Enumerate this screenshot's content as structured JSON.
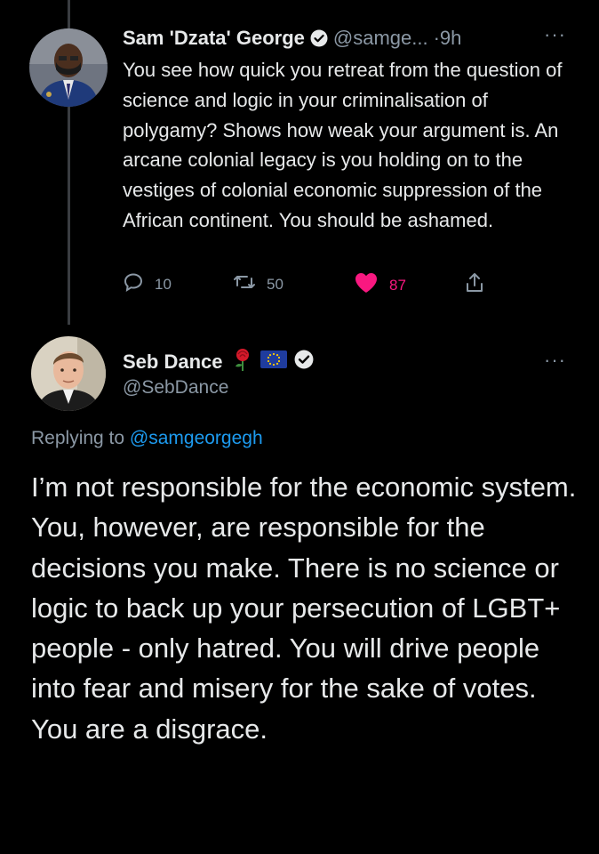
{
  "tweet1": {
    "name": "Sam 'Dzata' George",
    "handle": "@samge...",
    "time": "·9h",
    "more": "···",
    "text": "You see how quick you retreat from the question of science and logic in your criminalisation of polygamy? Shows how weak your argument is. An arcane colonial legacy is you holding on to the vestiges of colonial economic suppression of the African continent. You should be ashamed.",
    "replies": "10",
    "retweets": "50",
    "likes": "87",
    "liked": true,
    "icons": [
      "verified-badge-icon",
      "reply-icon",
      "retweet-icon",
      "heart-icon",
      "share-icon",
      "more-icon"
    ]
  },
  "tweet2": {
    "name": "Seb Dance",
    "handle": "@SebDance",
    "more": "···",
    "replying_prefix": "Replying to",
    "replying_to": "@samgeorgegh",
    "text": "I’m not responsible for the economic system. You, however, are responsible for the decisions you make. There is no science or logic to back up your persecution of LGBT+ people - only hatred. You will drive people into fear and misery for the sake of votes. You are a disgrace.",
    "icons": [
      "rose-icon",
      "eu-flag-icon",
      "verified-badge-icon"
    ]
  },
  "colors": {
    "background": "#000000",
    "text": "#e7e9ea",
    "muted": "#8b98a5",
    "accent": "#1d9bf0",
    "like": "#f91880",
    "thread_line": "#3a3d41"
  }
}
